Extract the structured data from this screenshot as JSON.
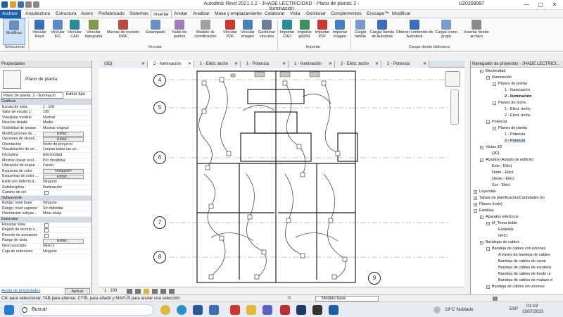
{
  "window": {
    "title": "Autodesk Revit 2021.1.2 - JHADE LECTRICIDAD - Plano de planta: 2 - Iluminación",
    "user": "U20208997"
  },
  "menu": [
    "Archivo",
    "Arquitectura",
    "Estructura",
    "Acero",
    "Prefabricado",
    "Sistemas",
    "Insertar",
    "Anotar",
    "Analizar",
    "Masa y emplazamiento",
    "Colaborar",
    "Vista",
    "Gestionar",
    "Complementos",
    "Enscape™",
    "Modificar"
  ],
  "ribbon": {
    "buttons": [
      "Modificar",
      "Vincular Revit",
      "Vincular IFC",
      "Vincular CAD",
      "Vincular topografía",
      "Marcas de revisión DWF",
      "Estampado",
      "Nube de puntos",
      "Modelo de coordinación",
      "Vincular PDF",
      "Vincular imagen",
      "Gestionar vínculos",
      "Importar CAD",
      "Importar gbXML",
      "Importar PDF",
      "Importar imagen",
      "Cargar familia",
      "Cargar familia de Autodesk",
      "Obtener contenido de Autodesk",
      "Cargar como grupo",
      "Insertar desde archivo"
    ],
    "panels": [
      "Seleccionar",
      "Vincular",
      "Importar",
      "Cargar desde biblioteca"
    ]
  },
  "tabs": [
    "{3D}",
    "2 - Iluminación",
    "1 - Eléct. techo",
    "1 - Potencia",
    "1 - Iluminación",
    "2 - Eléct. techo",
    "2 - Potencia"
  ],
  "properties": {
    "header": "Propiedades",
    "type": "Plano de planta",
    "selector": "Plano de planta: 2 - Iluminació",
    "edit_type": "Editar tipo",
    "groups": [
      {
        "name": "Gráficos",
        "rows": [
          [
            "Escala de vista",
            "1 : 100"
          ],
          [
            "Valor de escala 1:",
            "100"
          ],
          [
            "Visualizar modelo",
            "Normal"
          ],
          [
            "Nivel de detalle",
            "Medio"
          ],
          [
            "Visibilidad de piezas",
            "Mostrar original"
          ],
          [
            "Modificaciones de ...",
            "Editar..."
          ],
          [
            "Opciones de visuali...",
            "Editar..."
          ],
          [
            "Orientación",
            "Norte de proyecto"
          ],
          [
            "Visualización de un...",
            "Limpiar todas las un..."
          ],
          [
            "Disciplina",
            "Electricidad"
          ],
          [
            "Mostrar líneas ocul...",
            "Por disciplina"
          ],
          [
            "Ubicación de esque...",
            "Fondo"
          ],
          [
            "Esquema de color",
            "<ninguno>"
          ],
          [
            "Esquemas de color ...",
            "Editar..."
          ],
          [
            "Estilo por defecto d...",
            "Ninguno"
          ],
          [
            "Subdisciplina",
            "Iluminación"
          ],
          [
            "Camino de sol",
            ""
          ]
        ]
      },
      {
        "name": "Subyacente",
        "rows": [
          [
            "Rango: nivel base",
            "Ninguno"
          ],
          [
            "Rango: nivel superior",
            "Sin delimitar"
          ],
          [
            "Orientación subyac...",
            "Mirar abajo"
          ]
        ]
      },
      {
        "name": "Extensión",
        "rows": [
          [
            "Recortar vista",
            ""
          ],
          [
            "Región de recorte v...",
            ""
          ],
          [
            "Recorte de anotación",
            ""
          ],
          [
            "Rango de vista",
            "Editar..."
          ],
          [
            "Nivel asociado",
            "Nivel 2"
          ],
          [
            "Caja de referencia",
            "Ninguno"
          ]
        ]
      }
    ],
    "help": "Ayuda de propiedades",
    "apply": "Aplicar"
  },
  "canvas": {
    "grid_labels": [
      "4",
      "5",
      "6",
      "7",
      "8",
      "9"
    ]
  },
  "viewbar": {
    "scale": "1 : 100"
  },
  "browser": {
    "header": "Navegador de proyectos - JHADE LECTRICI...",
    "nodes": [
      "Electricidad",
      "Iluminación",
      "Planos de planta",
      "1 - Iluminación",
      "2 - Iluminación",
      "Planos de techo",
      "1 - Eléct. techo",
      "2 - Eléct. techo",
      "Potencia",
      "Planos de planta",
      "1 - Potencia",
      "2 - Potencia",
      "Vistas 3D",
      "{3D}",
      "Alzados (Alzado de edificio)",
      "Este - Eléct",
      "Norte - Eléct",
      "Oeste - Eléct",
      "Sur - Eléct",
      "Leyendas",
      "Tablas de planificación/Cantidades (to",
      "Planos (todo)",
      "Familias",
      "Aparatos eléctricos",
      "M_Toma doble",
      "Estándar",
      "GFCI",
      "Bandejas de cables",
      "Bandeja de cables con uniones",
      "A través de bandeja de cables",
      "Bandeja de cables de canal",
      "Bandeja de cables de escalera",
      "Bandeja de cables de fondo ur",
      "Bandeja de cables de malazo d",
      "Bandeja de cables sin uniones"
    ]
  },
  "status": {
    "hint": "Clic para seleccionar, TAB para alternar, CTRL para añadir y MAYÚS para anular una selección.",
    "selector_count": ":0",
    "model": "Modelo base"
  },
  "taskbar": {
    "search": "Buscar",
    "weather": "19°C  Nublado",
    "lang": "ESP",
    "time": "01:19",
    "date": "15/07/2023"
  }
}
